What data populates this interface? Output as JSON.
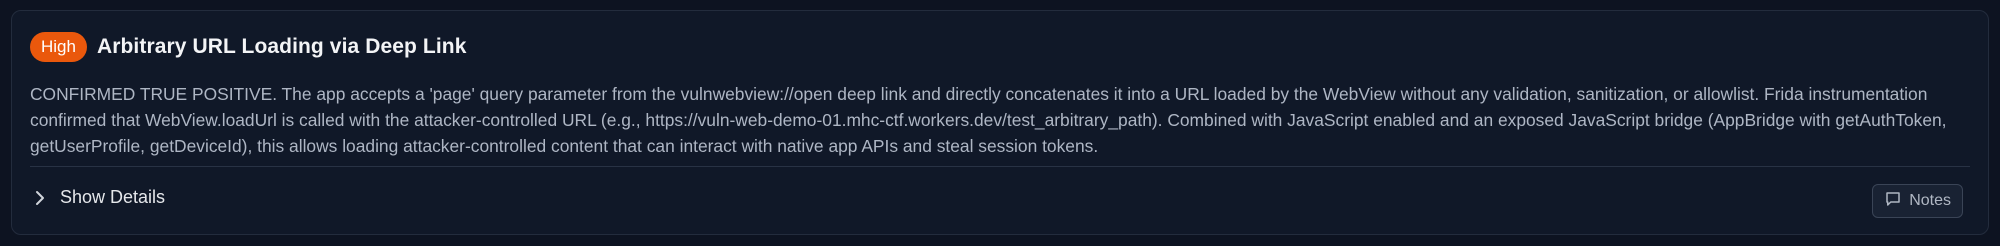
{
  "finding": {
    "severity": "High",
    "title": "Arbitrary URL Loading via Deep Link",
    "description": "CONFIRMED TRUE POSITIVE. The app accepts a 'page' query parameter from the vulnwebview://open deep link and directly concatenates it into a URL loaded by the WebView without any validation, sanitization, or allowlist. Frida instrumentation confirmed that WebView.loadUrl is called with the attacker-controlled URL (e.g., https://vuln-web-demo-01.mhc-ctf.workers.dev/test_arbitrary_path). Combined with JavaScript enabled and an exposed JavaScript bridge (AppBridge with getAuthToken, getUserProfile, getDeviceId), this allows loading attacker-controlled content that can interact with native app APIs and steal session tokens."
  },
  "actions": {
    "details_label": "Show Details",
    "details_icon": "chevron-right-icon",
    "notes_label": "Notes",
    "notes_icon": "message-square-icon"
  },
  "colors": {
    "severity_high": "#ea580c",
    "background": "#0d1321",
    "card": "#101828"
  }
}
